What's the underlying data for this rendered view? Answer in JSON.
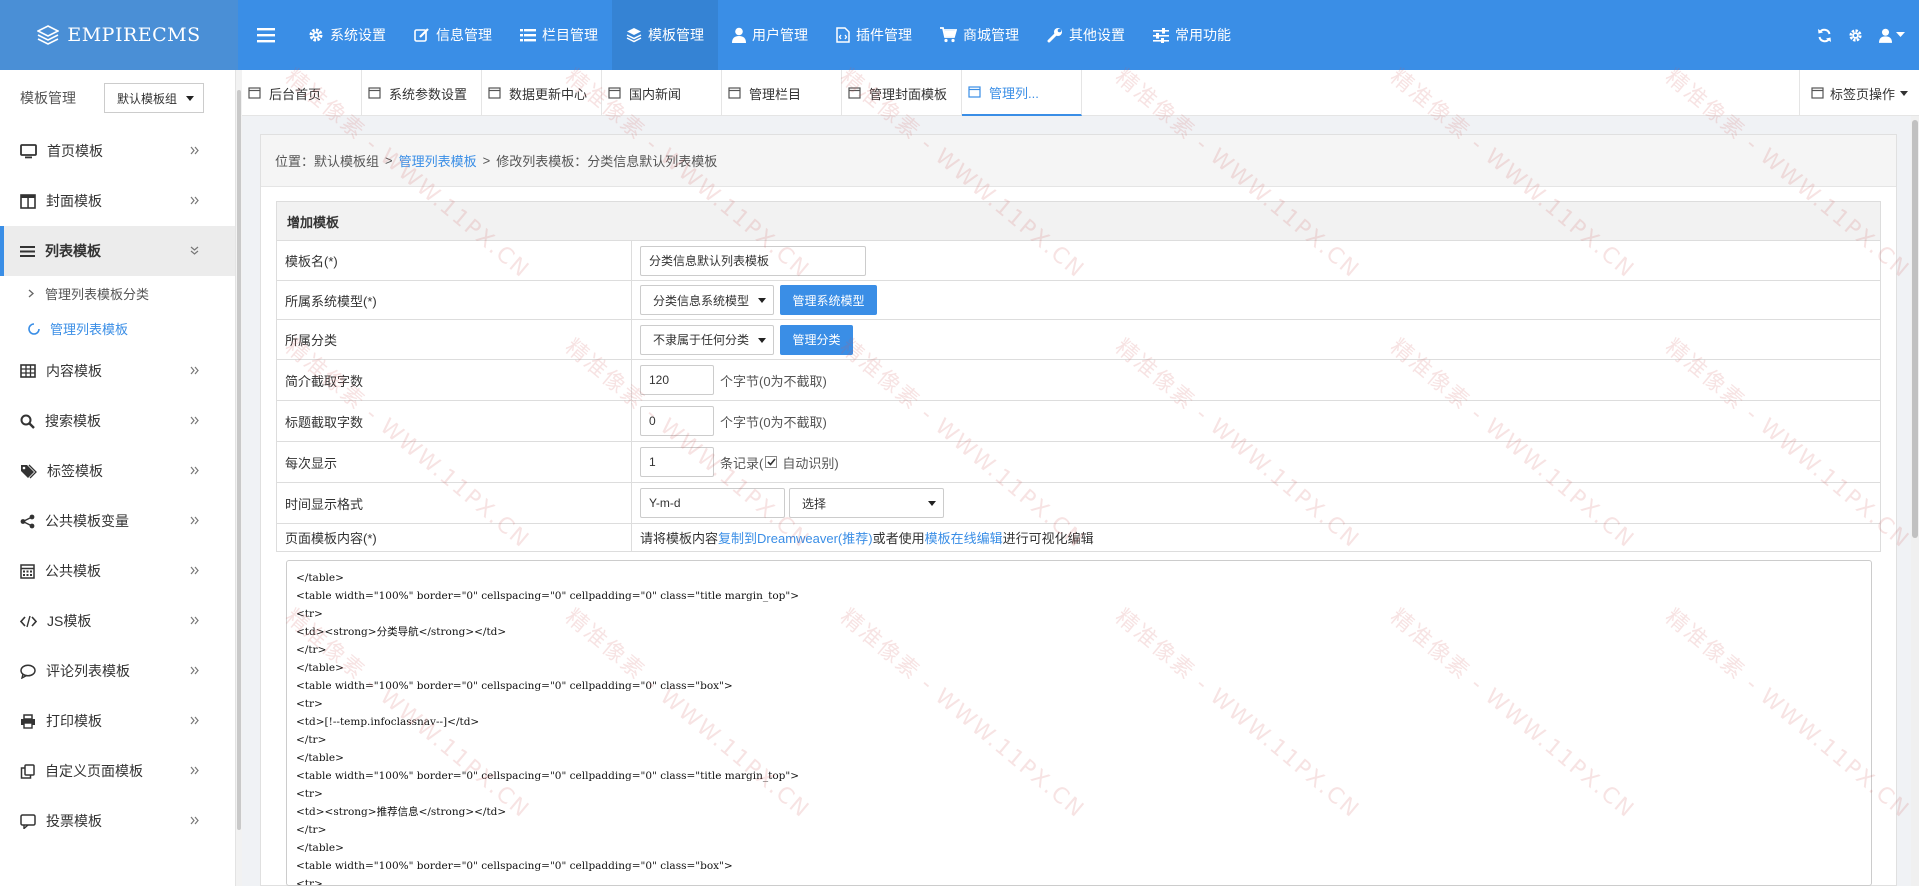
{
  "brand": {
    "name": "EMPIRECMS",
    "icon": "layers-icon"
  },
  "topnav": [
    {
      "label": "系统设置",
      "icon": "gear-icon"
    },
    {
      "label": "信息管理",
      "icon": "edit-icon"
    },
    {
      "label": "栏目管理",
      "icon": "list-icon"
    },
    {
      "label": "模板管理",
      "icon": "layers-icon",
      "active": true
    },
    {
      "label": "用户管理",
      "icon": "user-icon"
    },
    {
      "label": "插件管理",
      "icon": "file-code-icon"
    },
    {
      "label": "商城管理",
      "icon": "cart-icon"
    },
    {
      "label": "其他设置",
      "icon": "wrench-icon"
    },
    {
      "label": "常用功能",
      "icon": "sliders-icon"
    }
  ],
  "sidebar": {
    "title": "模板管理",
    "group_select": "默认模板组",
    "items": [
      {
        "label": "首页模板",
        "icon": "desktop-icon"
      },
      {
        "label": "封面模板",
        "icon": "columns-icon"
      },
      {
        "label": "列表模板",
        "icon": "list-icon",
        "active": true,
        "children": [
          {
            "label": "管理列表模板分类"
          },
          {
            "label": "管理列表模板",
            "active": true
          }
        ]
      },
      {
        "label": "内容模板",
        "icon": "table-icon"
      },
      {
        "label": "搜索模板",
        "icon": "search-icon"
      },
      {
        "label": "标签模板",
        "icon": "tags-icon"
      },
      {
        "label": "公共模板变量",
        "icon": "share-icon"
      },
      {
        "label": "公共模板",
        "icon": "calendar-icon"
      },
      {
        "label": "JS模板",
        "icon": "code-icon"
      },
      {
        "label": "评论列表模板",
        "icon": "comment-icon"
      },
      {
        "label": "打印模板",
        "icon": "print-icon"
      },
      {
        "label": "自定义页面模板",
        "icon": "copy-icon"
      },
      {
        "label": "投票模板",
        "icon": "message-icon"
      }
    ]
  },
  "tabs": [
    {
      "label": "后台首页"
    },
    {
      "label": "系统参数设置"
    },
    {
      "label": "数据更新中心"
    },
    {
      "label": "国内新闻"
    },
    {
      "label": "管理栏目"
    },
    {
      "label": "管理封面模板"
    },
    {
      "label": "管理列...",
      "active": true
    }
  ],
  "tab_ops": "标签页操作",
  "breadcrumb": {
    "prefix": "位置：默认模板组",
    "sep": ">",
    "link": "管理列表模板",
    "current": "修改列表模板：分类信息默认列表模板"
  },
  "form": {
    "header": "增加模板",
    "name_label": "模板名(*)",
    "name_value": "分类信息默认列表模板",
    "model_label": "所属系统模型(*)",
    "model_value": "分类信息系统模型",
    "model_btn": "管理系统模型",
    "class_label": "所属分类",
    "class_value": "不隶属于任何分类",
    "class_btn": "管理分类",
    "intro_label": "简介截取字数",
    "intro_value": "120",
    "intro_hint": "个字节(0为不截取)",
    "title_label": "标题截取字数",
    "title_value": "0",
    "title_hint": "个字节(0为不截取)",
    "pernum_label": "每次显示",
    "pernum_value": "1",
    "pernum_hint": "条记录(",
    "auto_label": "自动识别)",
    "auto_checked": true,
    "time_label": "时间显示格式",
    "time_value": "Y-m-d",
    "time_select": "选择",
    "content_label": "页面模板内容(*)",
    "content_hint_a": "请将模板内容",
    "content_link_a": "复制到Dreamweaver(推荐)",
    "content_hint_b": "或者使用",
    "content_link_b": "模板在线编辑",
    "content_hint_c": "进行可视化编辑"
  },
  "code_lines": [
    "</table>",
    "<table width=\"100%\" border=\"0\" cellspacing=\"0\" cellpadding=\"0\" class=\"title margin_top\">",
    "<tr>",
    "<td><strong>分类导航</strong></td>",
    "</tr>",
    "</table>",
    "<table width=\"100%\" border=\"0\" cellspacing=\"0\" cellpadding=\"0\" class=\"box\">",
    "<tr>",
    "<td>[!--temp.infoclassnav--]</td>",
    "</tr>",
    "</table>",
    "<table width=\"100%\" border=\"0\" cellspacing=\"0\" cellpadding=\"0\" class=\"title margin_top\">",
    "<tr>",
    "<td><strong>推荐信息</strong></td>",
    "</tr>",
    "</table>",
    "<table width=\"100%\" border=\"0\" cellspacing=\"0\" cellpadding=\"0\" class=\"box\">",
    "<tr>"
  ],
  "watermark": "精准像素 - WWW.11PX.CN",
  "colors": {
    "primary": "#3a8ee6",
    "brand_bg": "#4a8fd6",
    "active_nav": "#3583d4"
  }
}
